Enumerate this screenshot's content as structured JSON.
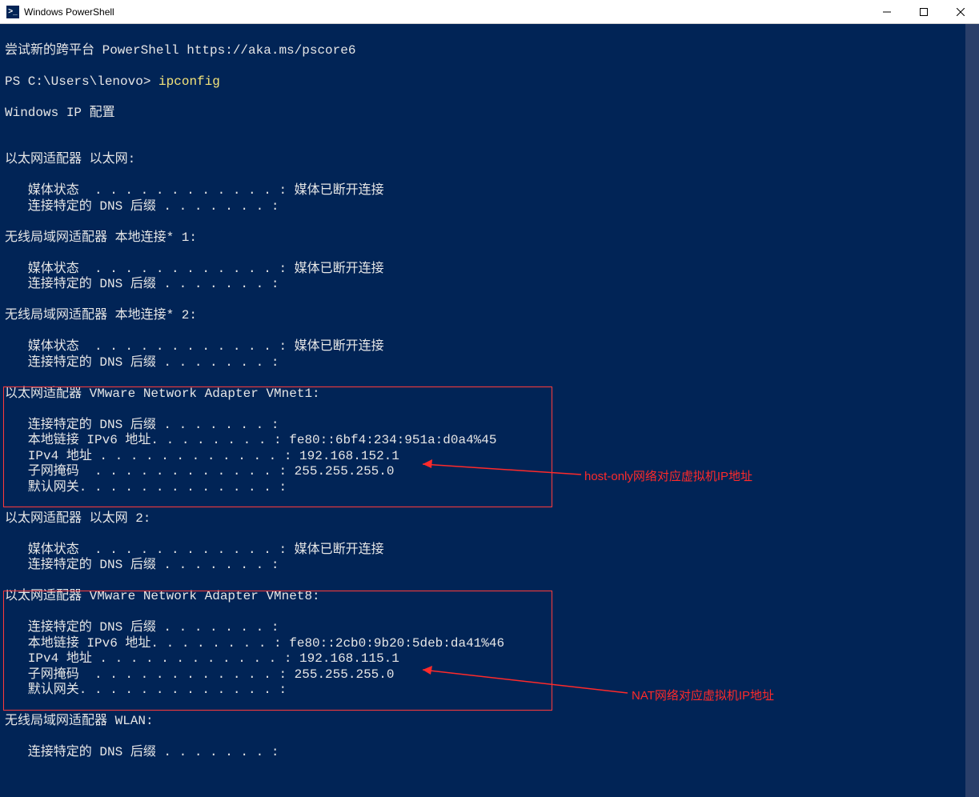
{
  "window": {
    "title": "Windows PowerShell",
    "icon_glyph": ">_"
  },
  "scrollback": {
    "banner": "尝试新的跨平台 PowerShell https://aka.ms/pscore6",
    "prompt_prefix": "PS C:\\Users\\lenovo> ",
    "command": "ipconfig",
    "header": "Windows IP 配置",
    "adapters": [
      {
        "title": "以太网适配器 以太网:",
        "lines": [
          "   媒体状态  . . . . . . . . . . . . : 媒体已断开连接",
          "   连接特定的 DNS 后缀 . . . . . . . :"
        ]
      },
      {
        "title": "无线局域网适配器 本地连接* 1:",
        "lines": [
          "   媒体状态  . . . . . . . . . . . . : 媒体已断开连接",
          "   连接特定的 DNS 后缀 . . . . . . . :"
        ]
      },
      {
        "title": "无线局域网适配器 本地连接* 2:",
        "lines": [
          "   媒体状态  . . . . . . . . . . . . : 媒体已断开连接",
          "   连接特定的 DNS 后缀 . . . . . . . :"
        ]
      },
      {
        "title": "以太网适配器 VMware Network Adapter VMnet1:",
        "lines": [
          "   连接特定的 DNS 后缀 . . . . . . . :",
          "   本地链接 IPv6 地址. . . . . . . . : fe80::6bf4:234:951a:d0a4%45",
          "   IPv4 地址 . . . . . . . . . . . . : 192.168.152.1",
          "   子网掩码  . . . . . . . . . . . . : 255.255.255.0",
          "   默认网关. . . . . . . . . . . . . :"
        ]
      },
      {
        "title": "以太网适配器 以太网 2:",
        "lines": [
          "   媒体状态  . . . . . . . . . . . . : 媒体已断开连接",
          "   连接特定的 DNS 后缀 . . . . . . . :"
        ]
      },
      {
        "title": "以太网适配器 VMware Network Adapter VMnet8:",
        "lines": [
          "   连接特定的 DNS 后缀 . . . . . . . :",
          "   本地链接 IPv6 地址. . . . . . . . : fe80::2cb0:9b20:5deb:da41%46",
          "   IPv4 地址 . . . . . . . . . . . . : 192.168.115.1",
          "   子网掩码  . . . . . . . . . . . . : 255.255.255.0",
          "   默认网关. . . . . . . . . . . . . :"
        ]
      },
      {
        "title": "无线局域网适配器 WLAN:",
        "lines": [
          "   连接特定的 DNS 后缀 . . . . . . . :"
        ]
      }
    ]
  },
  "annotations": {
    "vmnet1": "host-only网络对应虚拟机IP地址",
    "vmnet8": "NAT网络对应虚拟机IP地址"
  }
}
